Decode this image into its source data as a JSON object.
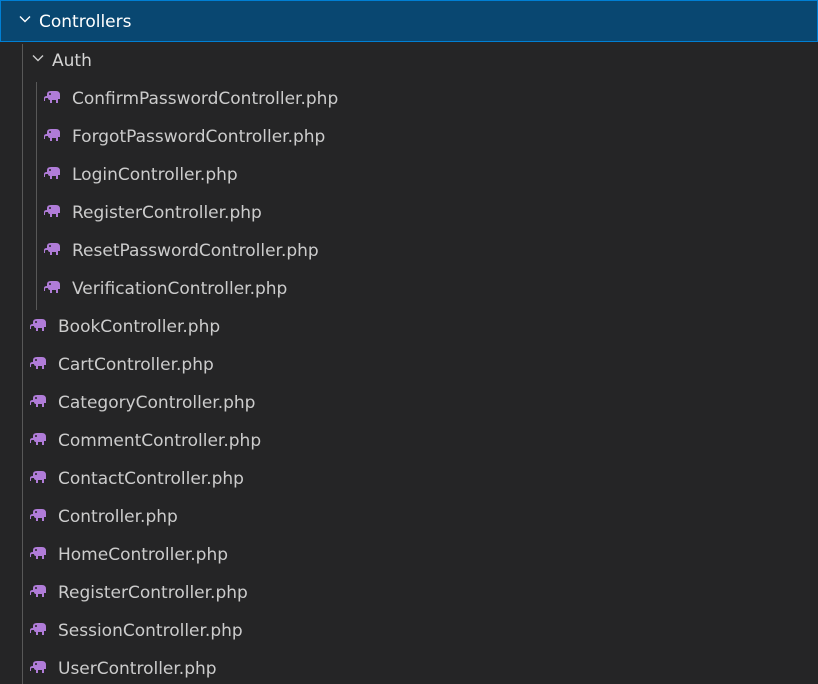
{
  "tree": {
    "root_folder": {
      "label": "Controllers",
      "expanded": true
    },
    "sub_folder": {
      "label": "Auth",
      "expanded": true
    },
    "auth_files": [
      {
        "label": "ConfirmPasswordController.php",
        "icon": "php-elephant-icon"
      },
      {
        "label": "ForgotPasswordController.php",
        "icon": "php-elephant-icon"
      },
      {
        "label": "LoginController.php",
        "icon": "php-elephant-icon"
      },
      {
        "label": "RegisterController.php",
        "icon": "php-elephant-icon"
      },
      {
        "label": "ResetPasswordController.php",
        "icon": "php-elephant-icon"
      },
      {
        "label": "VerificationController.php",
        "icon": "php-elephant-icon"
      }
    ],
    "files": [
      {
        "label": "BookController.php",
        "icon": "php-elephant-icon"
      },
      {
        "label": "CartController.php",
        "icon": "php-elephant-icon"
      },
      {
        "label": "CategoryController.php",
        "icon": "php-elephant-icon"
      },
      {
        "label": "CommentController.php",
        "icon": "php-elephant-icon"
      },
      {
        "label": "ContactController.php",
        "icon": "php-elephant-icon"
      },
      {
        "label": "Controller.php",
        "icon": "php-elephant-icon"
      },
      {
        "label": "HomeController.php",
        "icon": "php-elephant-icon"
      },
      {
        "label": "RegisterController.php",
        "icon": "php-elephant-icon"
      },
      {
        "label": "SessionController.php",
        "icon": "php-elephant-icon"
      },
      {
        "label": "UserController.php",
        "icon": "php-elephant-icon"
      }
    ]
  },
  "colors": {
    "background": "#252526",
    "selected_row": "#094771",
    "selected_border": "#007fd4",
    "php_icon": "#b07cd8"
  }
}
